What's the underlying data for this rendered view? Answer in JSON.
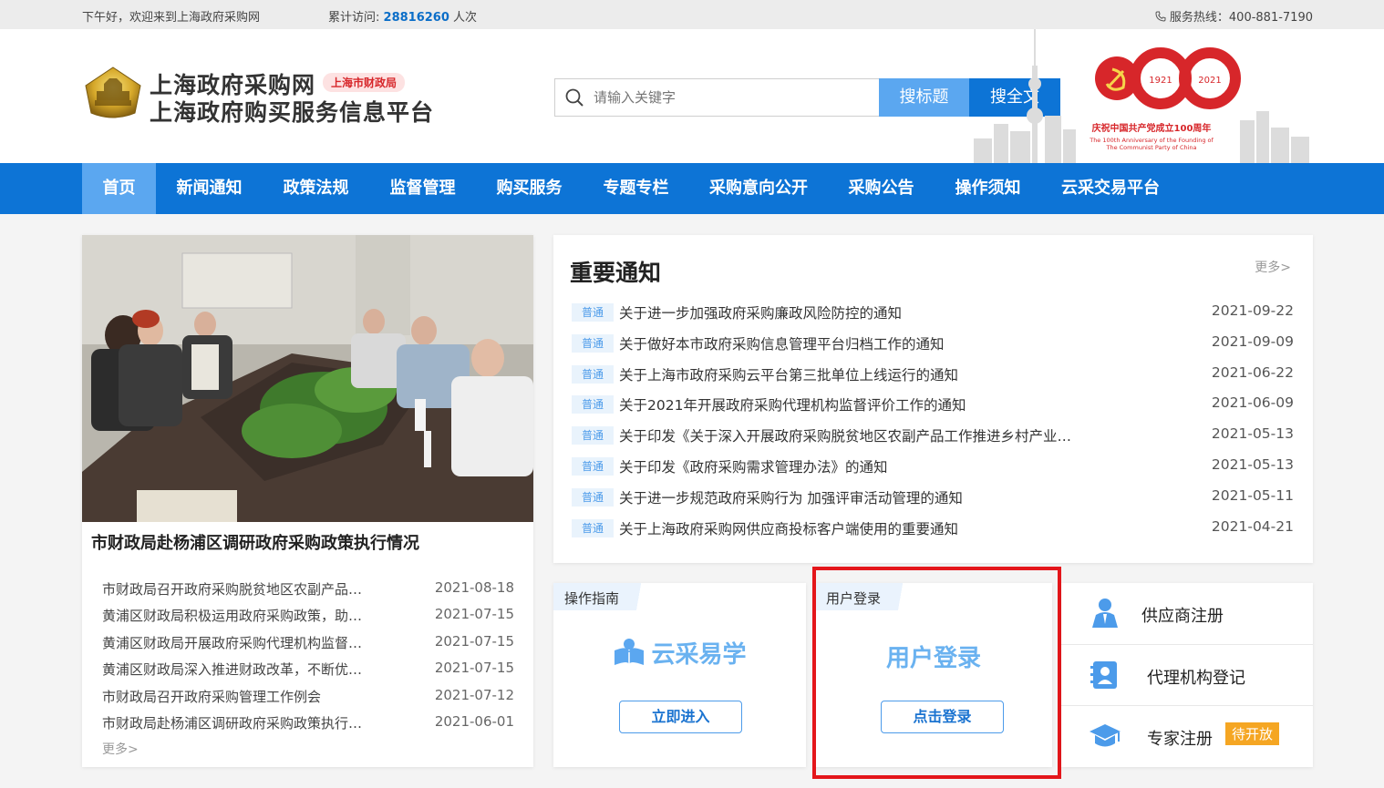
{
  "topbar": {
    "greeting": "下午好，欢迎来到上海政府采购网",
    "visits_label": "累计访问:",
    "visits_count": "28816260",
    "visits_unit": "人次",
    "hotline": "服务热线：400-881-7190"
  },
  "header": {
    "site_name": "上海政府采购网",
    "org_badge": "上海市财政局",
    "site_subtitle": "上海政府购买服务信息平台",
    "anniversary_title": "庆祝中国共产党成立100周年",
    "anniversary_en_1": "The 100th Anniversary of the Founding of",
    "anniversary_en_2": "The Communist Party of China",
    "anniversary_year_1": "1921",
    "anniversary_year_2": "2021"
  },
  "search": {
    "placeholder": "请输入关键字",
    "btn_title": "搜标题",
    "btn_full": "搜全文"
  },
  "nav": {
    "items": [
      "首页",
      "新闻通知",
      "政策法规",
      "监督管理",
      "购买服务",
      "专题专栏",
      "采购意向公开",
      "采购公告",
      "操作须知",
      "云采交易平台"
    ]
  },
  "photo_news": {
    "caption": "市财政局赴杨浦区调研政府采购政策执行情况",
    "items": [
      {
        "title": "市财政局召开政府采购脱贫地区农副产品工作推进会",
        "date": "2021-08-18"
      },
      {
        "title": "黄浦区财政局积极运用政府采购政策，助力中小企业发展",
        "date": "2021-07-15"
      },
      {
        "title": "黄浦区财政局开展政府采购代理机构监督评价工作",
        "date": "2021-07-15"
      },
      {
        "title": "黄浦区财政局深入推进财政改革，不断优化营商环境",
        "date": "2021-07-15"
      },
      {
        "title": "市财政局召开政府采购管理工作例会",
        "date": "2021-07-12"
      },
      {
        "title": "市财政局赴杨浦区调研政府采购政策执行情况",
        "date": "2021-06-01"
      }
    ],
    "more": "更多>"
  },
  "notices": {
    "title": "重要通知",
    "more": "更多>",
    "items": [
      {
        "tag": "普通",
        "title": "关于进一步加强政府采购廉政风险防控的通知",
        "date": "2021-09-22"
      },
      {
        "tag": "普通",
        "title": "关于做好本市政府采购信息管理平台归档工作的通知",
        "date": "2021-09-09"
      },
      {
        "tag": "普通",
        "title": "关于上海市政府采购云平台第三批单位上线运行的通知",
        "date": "2021-06-22"
      },
      {
        "tag": "普通",
        "title": "关于2021年开展政府采购代理机构监督评价工作的通知",
        "date": "2021-06-09"
      },
      {
        "tag": "普通",
        "title": "关于印发《关于深入开展政府采购脱贫地区农副产品工作推进乡村产业振兴的实施意见》的通知",
        "date": "2021-05-13"
      },
      {
        "tag": "普通",
        "title": "关于印发《政府采购需求管理办法》的通知",
        "date": "2021-05-13"
      },
      {
        "tag": "普通",
        "title": "关于进一步规范政府采购行为 加强评审活动管理的通知",
        "date": "2021-05-11"
      },
      {
        "tag": "普通",
        "title": "关于上海政府采购网供应商投标客户端使用的重要通知",
        "date": "2021-04-21"
      }
    ]
  },
  "guide": {
    "head": "操作指南",
    "title": "云采易学",
    "button": "立即进入"
  },
  "login": {
    "head": "用户登录",
    "title": "用户登录",
    "button": "点击登录"
  },
  "registration": {
    "supplier": "供应商注册",
    "agency": "代理机构登记",
    "expert": "专家注册",
    "expert_status": "待开放"
  },
  "colors": {
    "brand_blue": "#0d74d6",
    "light_blue": "#5ba7f0",
    "highlight_red": "#e4161b",
    "pending_orange": "#f5a623"
  }
}
